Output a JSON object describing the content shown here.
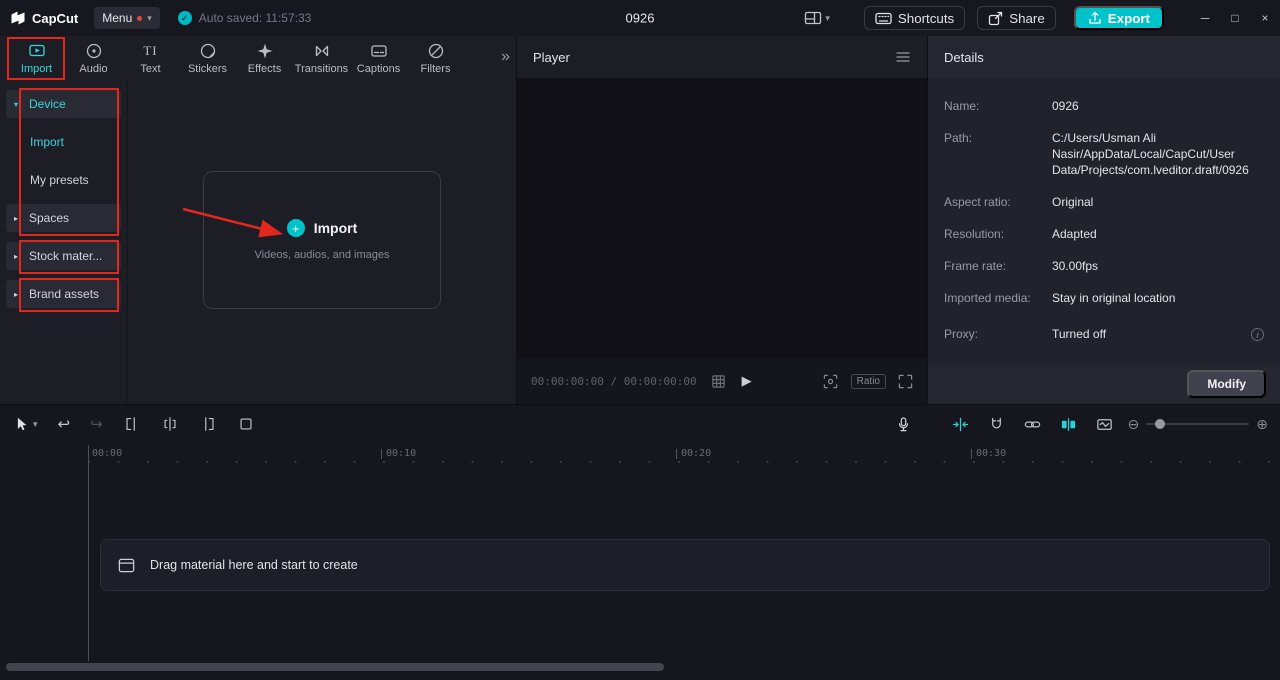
{
  "titlebar": {
    "logo_text": "CapCut",
    "menu_label": "Menu",
    "autosave_text": "Auto saved: 11:57:33",
    "project_title": "0926",
    "shortcuts_label": "Shortcuts",
    "share_label": "Share",
    "export_label": "Export"
  },
  "media": {
    "tabs": [
      {
        "label": "Import"
      },
      {
        "label": "Audio"
      },
      {
        "label": "Text"
      },
      {
        "label": "Stickers"
      },
      {
        "label": "Effects"
      },
      {
        "label": "Transitions"
      },
      {
        "label": "Captions"
      },
      {
        "label": "Filters"
      }
    ],
    "sidebar": [
      {
        "caret": "▾",
        "label": "Device"
      },
      {
        "label": "Import"
      },
      {
        "label": "My presets"
      },
      {
        "caret": "▸",
        "label": "Spaces"
      },
      {
        "caret": "▸",
        "label": "Stock mater..."
      },
      {
        "caret": "▸",
        "label": "Brand assets"
      }
    ],
    "import_box": {
      "title": "Import",
      "subtitle": "Videos, audios, and images"
    }
  },
  "player": {
    "title": "Player",
    "timecode": "00:00:00:00 / 00:00:00:00",
    "ratio_label": "Ratio"
  },
  "details": {
    "title": "Details",
    "rows": [
      {
        "label": "Name:",
        "value": "0926"
      },
      {
        "label": "Path:",
        "value": "C:/Users/Usman Ali Nasir/AppData/Local/CapCut/User Data/Projects/com.lveditor.draft/0926"
      },
      {
        "label": "Aspect ratio:",
        "value": "Original"
      },
      {
        "label": "Resolution:",
        "value": "Adapted"
      },
      {
        "label": "Frame rate:",
        "value": "30.00fps"
      },
      {
        "label": "Imported media:",
        "value": "Stay in original location"
      },
      {
        "label": "Proxy:",
        "value": "Turned off"
      }
    ],
    "modify_label": "Modify"
  },
  "timeline": {
    "marks": [
      "00:00",
      "00:10",
      "00:20",
      "00:30"
    ],
    "empty_text": "Drag material here and start to create"
  },
  "icons": {
    "caret_down": "▾",
    "check": "✓",
    "more": "»",
    "plus": "+",
    "play": "▶",
    "undo": "↩",
    "redo": "↪",
    "zoom_out": "⊖",
    "zoom_in": "⊕",
    "minimize": "─",
    "maximize": "□",
    "close": "×",
    "text_tab_glyph": "TI",
    "info": "i"
  },
  "colors": {
    "accent": "#00c2cb",
    "annotation": "#e1271e"
  }
}
